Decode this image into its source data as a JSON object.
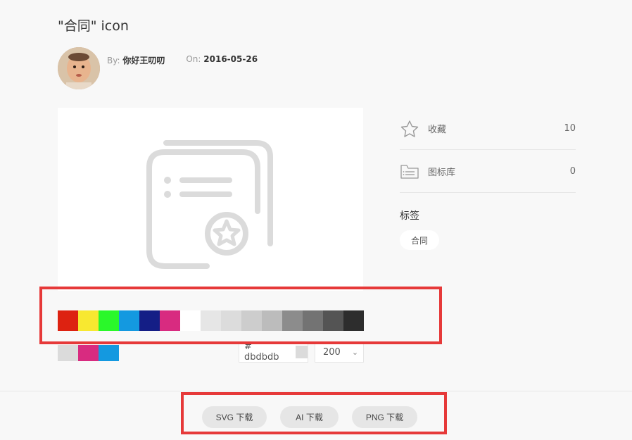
{
  "page": {
    "title": "\"合同\" icon"
  },
  "meta": {
    "by_label": "By:",
    "author": "你好王叨叨",
    "on_label": "On:",
    "date": "2016-05-26"
  },
  "palette": {
    "swatches": [
      "#dd2211",
      "#f8e830",
      "#2af82a",
      "#1499e0",
      "#141e86",
      "#d82b80",
      "#ffffff",
      "#e6e6e6",
      "#dcdcdc",
      "#cdcdcd",
      "#bcbcbc",
      "#8c8c8c",
      "#737373",
      "#545454",
      "#2d2d2d"
    ],
    "recent": [
      "#dbdbdb",
      "#d82b80",
      "#1499e0"
    ],
    "hex_label": "# dbdbdb",
    "hex_color": "#dbdbdb",
    "size_value": "200",
    "size_caret": "⌄"
  },
  "sidebar": {
    "favorite_label": "收藏",
    "favorite_count": "10",
    "library_label": "图标库",
    "library_count": "0",
    "tags_label": "标签",
    "tags": [
      "合同"
    ]
  },
  "downloads": {
    "svg": "SVG 下载",
    "ai": "AI 下载",
    "png": "PNG 下载"
  },
  "colors": {
    "icon": "#dbdbdb",
    "highlight": "#e63939"
  }
}
